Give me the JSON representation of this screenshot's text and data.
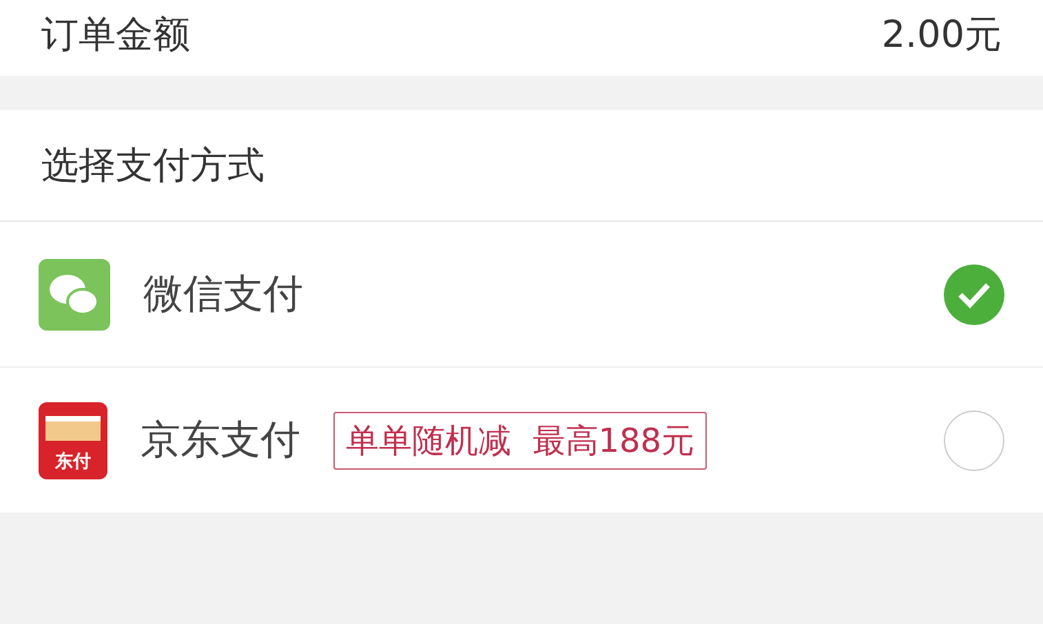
{
  "order_amount": {
    "label": "订单金额",
    "value": "2.00元"
  },
  "payment": {
    "title": "选择支付方式",
    "methods": [
      {
        "kind": "wechat",
        "name": "微信支付",
        "selected": true
      },
      {
        "kind": "jd",
        "name": "京东支付",
        "logo_text": "东付",
        "promo": "单单随机减  最高188元",
        "selected": false
      }
    ]
  }
}
